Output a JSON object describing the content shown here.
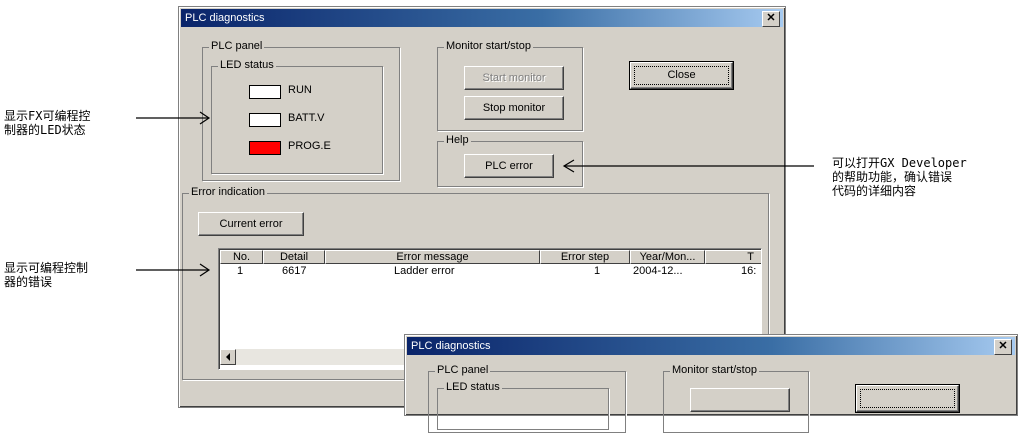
{
  "main_window": {
    "title": "PLC diagnostics",
    "close_glyph": "✕",
    "plc_panel": {
      "legend": "PLC panel",
      "led_status": {
        "legend": "LED status",
        "leds": [
          {
            "label": "RUN",
            "color": "#ffffff"
          },
          {
            "label": "BATT.V",
            "color": "#ffffff"
          },
          {
            "label": "PROG.E",
            "color": "#ff0000"
          }
        ]
      }
    },
    "monitor": {
      "legend": "Monitor start/stop",
      "start_label": "Start monitor",
      "stop_label": "Stop monitor"
    },
    "close_label": "Close",
    "help": {
      "legend": "Help",
      "plc_error_label": "PLC error"
    },
    "error_indication": {
      "legend": "Error indication",
      "current_error_label": "Current error",
      "columns": [
        "No.",
        "Detail",
        "Error message",
        "Error step",
        "Year/Mon...",
        "T"
      ],
      "rows": [
        {
          "no": "1",
          "detail": "6617",
          "message": "Ladder error",
          "step": "1",
          "date": "2004-12...",
          "time": "16:"
        }
      ]
    }
  },
  "second_window": {
    "title": "PLC diagnostics",
    "plc_panel_legend": "PLC panel",
    "led_status_legend": "LED status",
    "monitor_legend": "Monitor start/stop"
  },
  "annotations": {
    "led_note": [
      "显示FX可编程控",
      "制器的LED状态"
    ],
    "error_note": [
      "显示可编程控制",
      "器的错误"
    ],
    "help_note": [
      "可以打开GX Developer",
      "的帮助功能，确认错误",
      "代码的详细内容"
    ]
  }
}
